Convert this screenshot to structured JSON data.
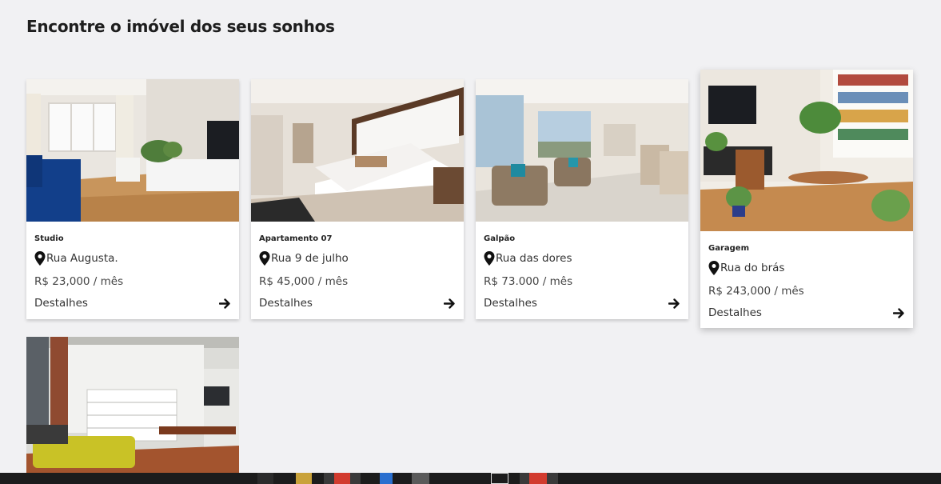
{
  "page": {
    "title": "Encontre o imóvel dos seus sonhos"
  },
  "properties": [
    {
      "name": "Studio",
      "address": "Rua Augusta.",
      "price": "R$ 23,000 / mês",
      "details_label": "Destalhes"
    },
    {
      "name": "Apartamento 07",
      "address": "Rua 9 de julho",
      "price": "R$ 45,000 / mês",
      "details_label": "Destalhes"
    },
    {
      "name": "Galpão",
      "address": "Rua das dores",
      "price": "R$ 73.000 / mês",
      "details_label": "Destalhes"
    },
    {
      "name": "Garagem",
      "address": "Rua do brás",
      "price": "R$ 243,000 / mês",
      "details_label": "Destalhes"
    },
    {
      "name": "",
      "address": "",
      "price": "",
      "details_label": ""
    }
  ],
  "icons": {
    "location": "map-pin-icon",
    "details": "arrow-right-icon"
  },
  "colors": {
    "background": "#f1f1f3",
    "card": "#ffffff",
    "text": "#222222",
    "taskbar": "#1c1c1c"
  }
}
